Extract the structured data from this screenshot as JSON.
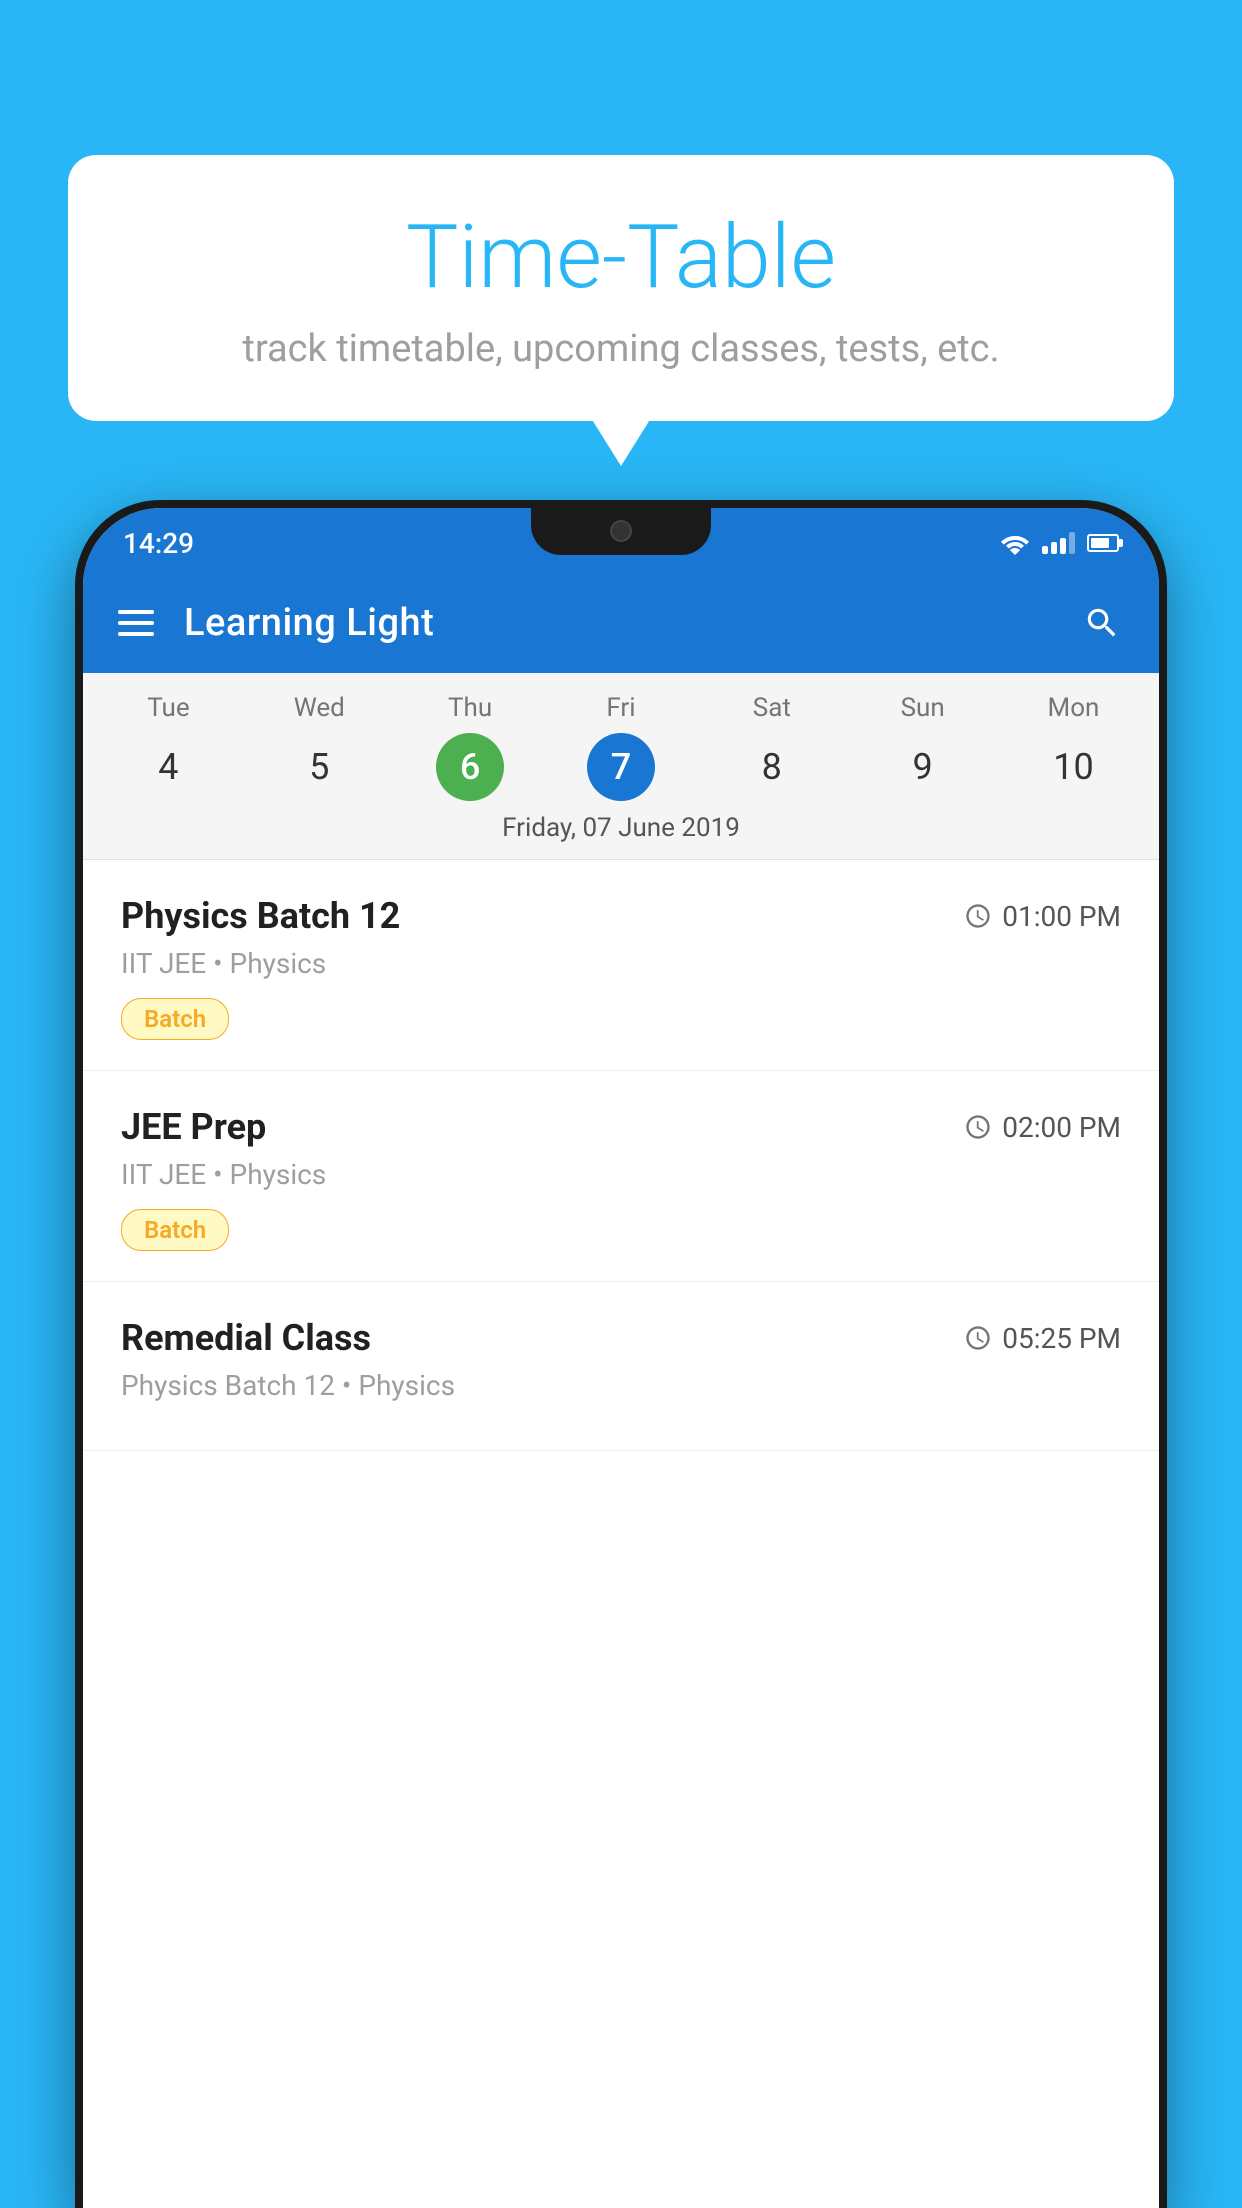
{
  "background_color": "#29B6F6",
  "speech_bubble": {
    "title": "Time-Table",
    "subtitle": "track timetable, upcoming classes, tests, etc."
  },
  "phone": {
    "status_bar": {
      "time": "14:29"
    },
    "app_bar": {
      "title": "Learning Light"
    },
    "calendar": {
      "days": [
        "Tue",
        "Wed",
        "Thu",
        "Fri",
        "Sat",
        "Sun",
        "Mon"
      ],
      "dates": [
        4,
        5,
        6,
        7,
        8,
        9,
        10
      ],
      "today_index": 2,
      "selected_index": 3,
      "selected_date_label": "Friday, 07 June 2019"
    },
    "classes": [
      {
        "name": "Physics Batch 12",
        "time": "01:00 PM",
        "subtitle": "IIT JEE • Physics",
        "badge": "Batch"
      },
      {
        "name": "JEE Prep",
        "time": "02:00 PM",
        "subtitle": "IIT JEE • Physics",
        "badge": "Batch"
      },
      {
        "name": "Remedial Class",
        "time": "05:25 PM",
        "subtitle": "Physics Batch 12 • Physics",
        "badge": null
      }
    ]
  }
}
